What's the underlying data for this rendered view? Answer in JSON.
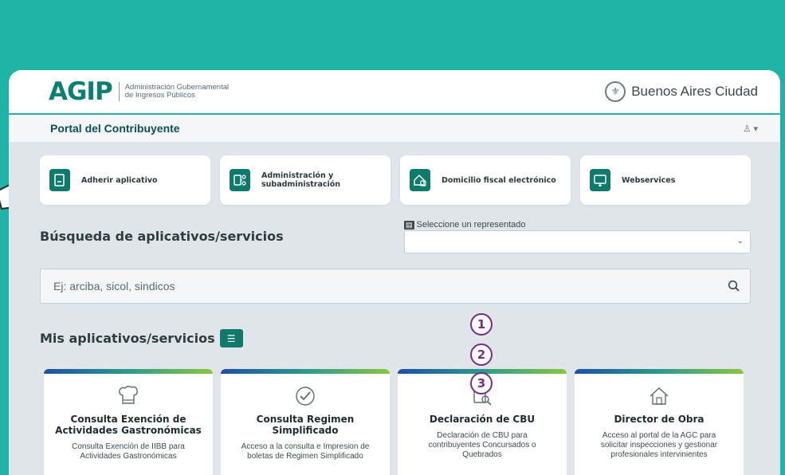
{
  "header": {
    "logo_text": "AGIP",
    "logo_subtitle_line1": "Administración Gubernamental",
    "logo_subtitle_line2": "de Ingresos Públicos",
    "city_name": "Buenos Aires Ciudad"
  },
  "portal": {
    "title": "Portal del Contribuyente",
    "user_menu": "▴ ▾"
  },
  "quick_actions": [
    {
      "label": "Adherir aplicativo",
      "icon": "document-icon"
    },
    {
      "label": "Administración y subadministración",
      "icon": "network-icon"
    },
    {
      "label": "Domicilio fiscal electrónico",
      "icon": "building-icon"
    },
    {
      "label": "Webservices",
      "icon": "monitor-icon"
    }
  ],
  "search": {
    "title": "Búsqueda de aplicativos/servicios",
    "representative_label": "Seleccione un representado",
    "representative_value": "",
    "placeholder": "Ej: arciba, sicol, sindicos"
  },
  "my_apps": {
    "title": "Mis aplicativos/servicios",
    "items": [
      {
        "title": "Consulta Exención de Actividades Gastronómicas",
        "description": "Consulta Exención de IIBB para Actividades Gastronómicas",
        "icon": "chef-hat-icon"
      },
      {
        "title": "Consulta Regimen Simplificado",
        "description": "Acceso a la consulta e Impresion de boletas de Regimen Simplificado",
        "icon": "check-badge-icon"
      },
      {
        "title": "Declaración de CBU",
        "description": "Declaración de CBU para contribuyentes Concursados o Quebrados",
        "icon": "document-search-icon"
      },
      {
        "title": "Director de Obra",
        "description": "Acceso al portal de la AGC para solicitar inspecciones y gestionar profesionales intervinientes",
        "icon": "house-icon"
      }
    ]
  },
  "annotations": [
    "1",
    "2",
    "3"
  ]
}
